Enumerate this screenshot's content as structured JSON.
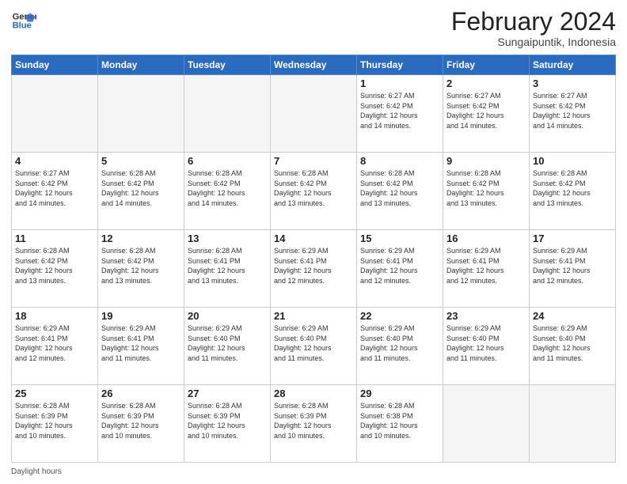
{
  "logo": {
    "line1": "General",
    "line2": "Blue"
  },
  "title": "February 2024",
  "subtitle": "Sungaipuntik, Indonesia",
  "days_of_week": [
    "Sunday",
    "Monday",
    "Tuesday",
    "Wednesday",
    "Thursday",
    "Friday",
    "Saturday"
  ],
  "weeks": [
    [
      {
        "day": "",
        "info": ""
      },
      {
        "day": "",
        "info": ""
      },
      {
        "day": "",
        "info": ""
      },
      {
        "day": "",
        "info": ""
      },
      {
        "day": "1",
        "info": "Sunrise: 6:27 AM\nSunset: 6:42 PM\nDaylight: 12 hours\nand 14 minutes."
      },
      {
        "day": "2",
        "info": "Sunrise: 6:27 AM\nSunset: 6:42 PM\nDaylight: 12 hours\nand 14 minutes."
      },
      {
        "day": "3",
        "info": "Sunrise: 6:27 AM\nSunset: 6:42 PM\nDaylight: 12 hours\nand 14 minutes."
      }
    ],
    [
      {
        "day": "4",
        "info": "Sunrise: 6:27 AM\nSunset: 6:42 PM\nDaylight: 12 hours\nand 14 minutes."
      },
      {
        "day": "5",
        "info": "Sunrise: 6:28 AM\nSunset: 6:42 PM\nDaylight: 12 hours\nand 14 minutes."
      },
      {
        "day": "6",
        "info": "Sunrise: 6:28 AM\nSunset: 6:42 PM\nDaylight: 12 hours\nand 14 minutes."
      },
      {
        "day": "7",
        "info": "Sunrise: 6:28 AM\nSunset: 6:42 PM\nDaylight: 12 hours\nand 13 minutes."
      },
      {
        "day": "8",
        "info": "Sunrise: 6:28 AM\nSunset: 6:42 PM\nDaylight: 12 hours\nand 13 minutes."
      },
      {
        "day": "9",
        "info": "Sunrise: 6:28 AM\nSunset: 6:42 PM\nDaylight: 12 hours\nand 13 minutes."
      },
      {
        "day": "10",
        "info": "Sunrise: 6:28 AM\nSunset: 6:42 PM\nDaylight: 12 hours\nand 13 minutes."
      }
    ],
    [
      {
        "day": "11",
        "info": "Sunrise: 6:28 AM\nSunset: 6:42 PM\nDaylight: 12 hours\nand 13 minutes."
      },
      {
        "day": "12",
        "info": "Sunrise: 6:28 AM\nSunset: 6:42 PM\nDaylight: 12 hours\nand 13 minutes."
      },
      {
        "day": "13",
        "info": "Sunrise: 6:28 AM\nSunset: 6:41 PM\nDaylight: 12 hours\nand 13 minutes."
      },
      {
        "day": "14",
        "info": "Sunrise: 6:29 AM\nSunset: 6:41 PM\nDaylight: 12 hours\nand 12 minutes."
      },
      {
        "day": "15",
        "info": "Sunrise: 6:29 AM\nSunset: 6:41 PM\nDaylight: 12 hours\nand 12 minutes."
      },
      {
        "day": "16",
        "info": "Sunrise: 6:29 AM\nSunset: 6:41 PM\nDaylight: 12 hours\nand 12 minutes."
      },
      {
        "day": "17",
        "info": "Sunrise: 6:29 AM\nSunset: 6:41 PM\nDaylight: 12 hours\nand 12 minutes."
      }
    ],
    [
      {
        "day": "18",
        "info": "Sunrise: 6:29 AM\nSunset: 6:41 PM\nDaylight: 12 hours\nand 12 minutes."
      },
      {
        "day": "19",
        "info": "Sunrise: 6:29 AM\nSunset: 6:41 PM\nDaylight: 12 hours\nand 11 minutes."
      },
      {
        "day": "20",
        "info": "Sunrise: 6:29 AM\nSunset: 6:40 PM\nDaylight: 12 hours\nand 11 minutes."
      },
      {
        "day": "21",
        "info": "Sunrise: 6:29 AM\nSunset: 6:40 PM\nDaylight: 12 hours\nand 11 minutes."
      },
      {
        "day": "22",
        "info": "Sunrise: 6:29 AM\nSunset: 6:40 PM\nDaylight: 12 hours\nand 11 minutes."
      },
      {
        "day": "23",
        "info": "Sunrise: 6:29 AM\nSunset: 6:40 PM\nDaylight: 12 hours\nand 11 minutes."
      },
      {
        "day": "24",
        "info": "Sunrise: 6:29 AM\nSunset: 6:40 PM\nDaylight: 12 hours\nand 11 minutes."
      }
    ],
    [
      {
        "day": "25",
        "info": "Sunrise: 6:28 AM\nSunset: 6:39 PM\nDaylight: 12 hours\nand 10 minutes."
      },
      {
        "day": "26",
        "info": "Sunrise: 6:28 AM\nSunset: 6:39 PM\nDaylight: 12 hours\nand 10 minutes."
      },
      {
        "day": "27",
        "info": "Sunrise: 6:28 AM\nSunset: 6:39 PM\nDaylight: 12 hours\nand 10 minutes."
      },
      {
        "day": "28",
        "info": "Sunrise: 6:28 AM\nSunset: 6:39 PM\nDaylight: 12 hours\nand 10 minutes."
      },
      {
        "day": "29",
        "info": "Sunrise: 6:28 AM\nSunset: 6:38 PM\nDaylight: 12 hours\nand 10 minutes."
      },
      {
        "day": "",
        "info": ""
      },
      {
        "day": "",
        "info": ""
      }
    ]
  ],
  "footer": "Daylight hours"
}
